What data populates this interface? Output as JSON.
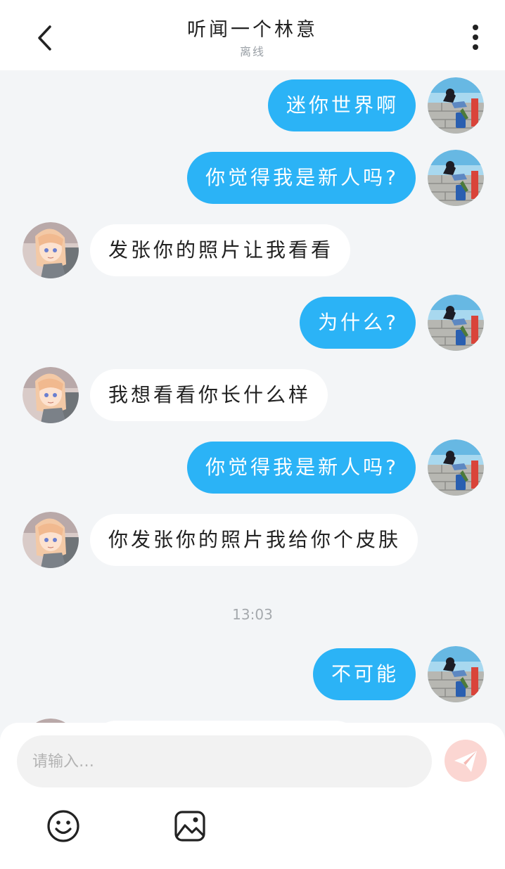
{
  "header": {
    "title": "听闻一个林意",
    "status": "离线"
  },
  "messages": [
    {
      "from": "me",
      "text": "迷你世界啊"
    },
    {
      "from": "me",
      "text": "你觉得我是新人吗?"
    },
    {
      "from": "other",
      "text": "发张你的照片让我看看"
    },
    {
      "from": "me",
      "text": "为什么?"
    },
    {
      "from": "other",
      "text": "我想看看你长什么样"
    },
    {
      "from": "me",
      "text": "你觉得我是新人吗?"
    },
    {
      "from": "other",
      "text": "你发张你的照片我给你个皮肤"
    },
    {
      "from": "me",
      "text": "不可能"
    }
  ],
  "timestamp": "13:03",
  "composer": {
    "placeholder": "请输入…",
    "value": ""
  },
  "colors": {
    "my_bubble": "#2bb3f6",
    "other_bubble": "#ffffff",
    "send_button": "#fbd6d2"
  },
  "icons": {
    "back": "chevron-left-icon",
    "menu": "more-vertical-icon",
    "send": "paper-plane-icon",
    "emoji": "smiley-icon",
    "image": "image-icon"
  }
}
